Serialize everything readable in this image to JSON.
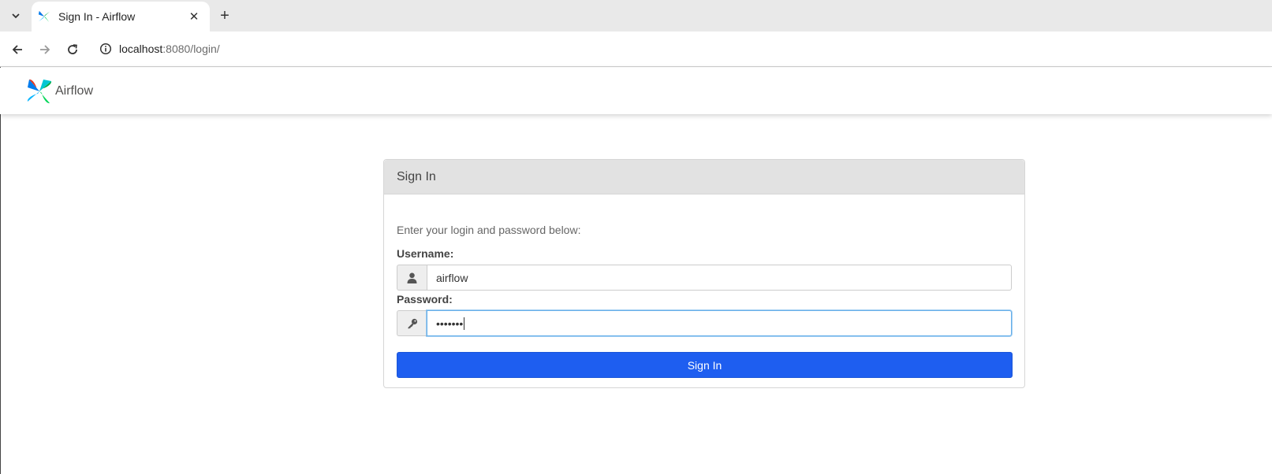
{
  "browser": {
    "tab_title": "Sign In - Airflow",
    "url_host": "localhost",
    "url_rest": ":8080/login/"
  },
  "navbar": {
    "brand_name": "Airflow"
  },
  "login": {
    "panel_title": "Sign In",
    "instructions": "Enter your login and password below:",
    "username_label": "Username:",
    "username_value": "airflow",
    "password_label": "Password:",
    "password_value": "•••••••",
    "submit_label": "Sign In"
  },
  "colors": {
    "primary_button": "#1e5ef0",
    "panel_header": "#e2e2e2"
  }
}
